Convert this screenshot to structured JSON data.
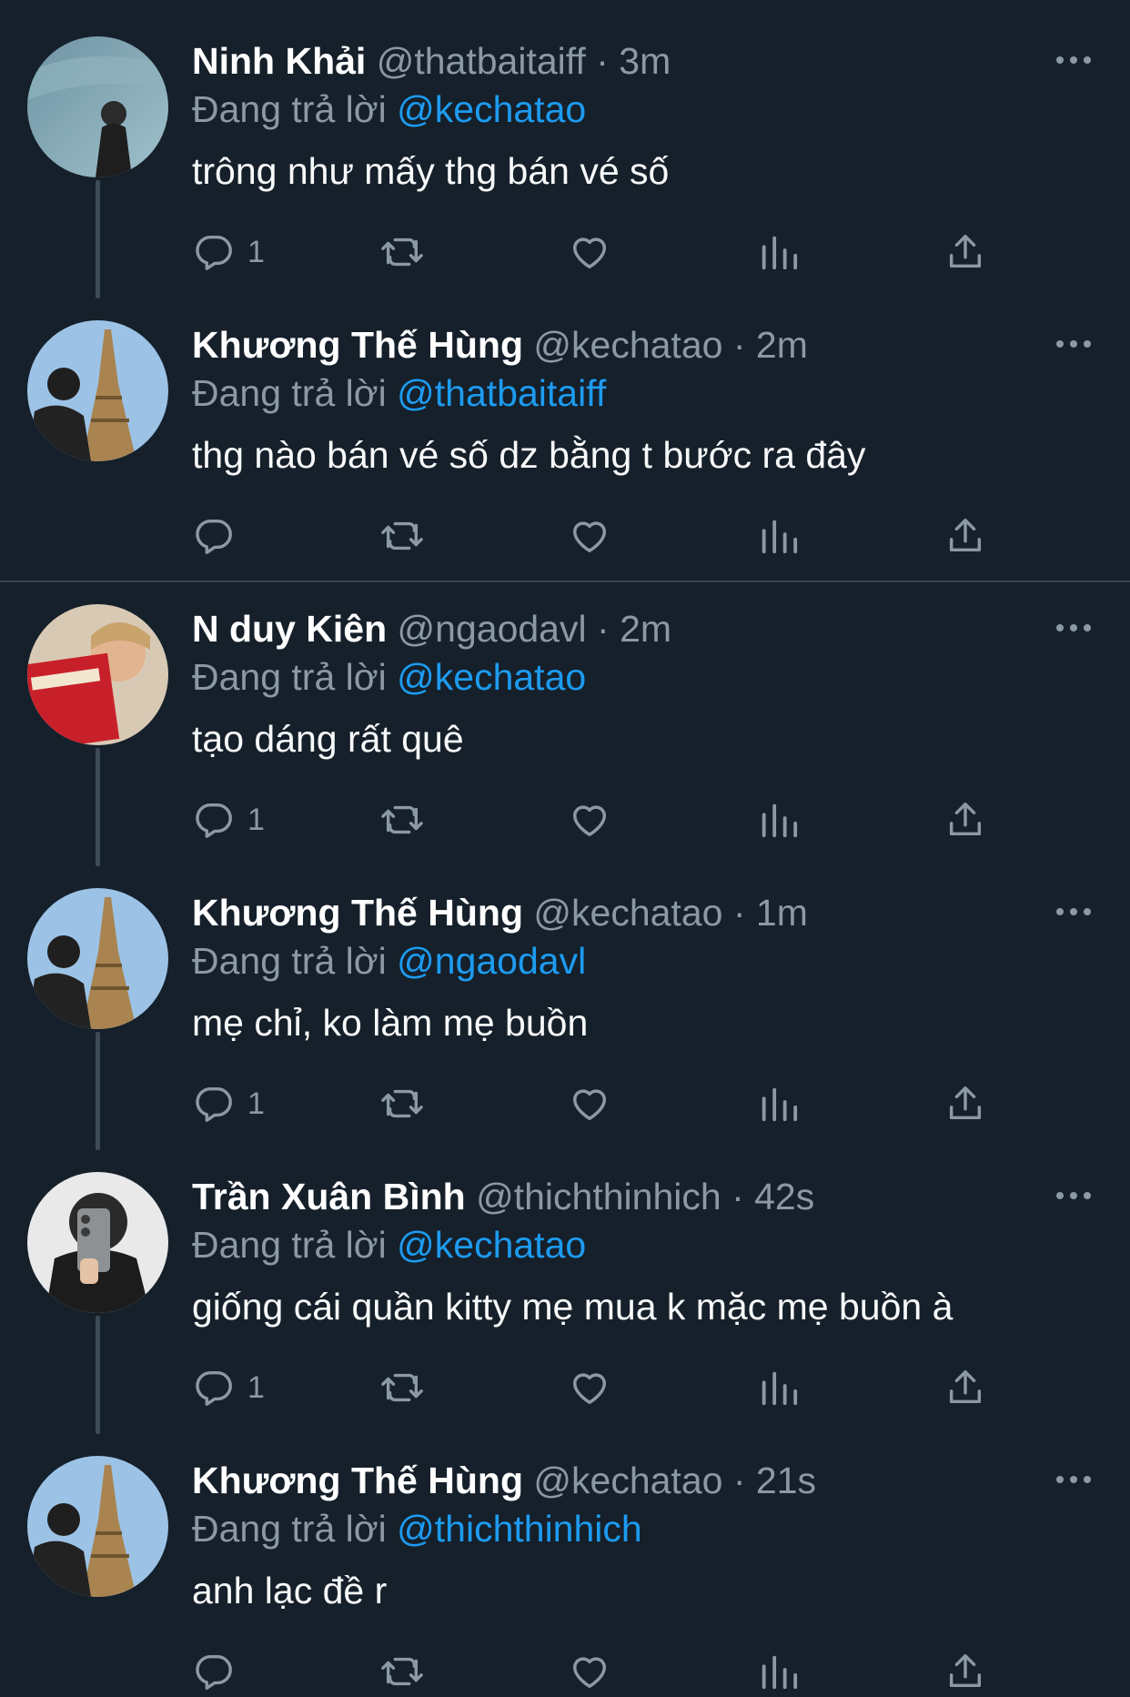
{
  "theme": {
    "background": "#15202b",
    "text_primary": "#ffffff",
    "text_secondary": "#8b98a5",
    "accent": "#1d9bf0",
    "thread_line": "#3d4a57",
    "divider": "#38444d"
  },
  "reply_prefix": "Đang trả lời",
  "icons": {
    "reply": "reply-bubble-icon",
    "retweet": "retweet-icon",
    "like": "heart-icon",
    "views": "views-bar-chart-icon",
    "share": "share-upload-icon",
    "more": "more-dots-icon"
  },
  "tweets": [
    {
      "display_name": "Ninh Khải",
      "handle": "@thatbaitaiff",
      "separator": "·",
      "time": "3m",
      "replying_to": "@kechatao",
      "text": "trông như mấy thg bán vé số",
      "reply_count": "1"
    },
    {
      "display_name": "Khương Thế Hùng",
      "handle": "@kechatao",
      "separator": "·",
      "time": "2m",
      "replying_to": "@thatbaitaiff",
      "text": "thg nào bán vé số dz bằng t bước ra đây",
      "reply_count": ""
    },
    {
      "display_name": "N duy Kiên",
      "handle": "@ngaodavl",
      "separator": "·",
      "time": "2m",
      "replying_to": "@kechatao",
      "text": "tạo dáng rất quê",
      "reply_count": "1"
    },
    {
      "display_name": "Khương Thế Hùng",
      "handle": "@kechatao",
      "separator": "·",
      "time": "1m",
      "replying_to": "@ngaodavl",
      "text": "mẹ chỉ, ko làm mẹ buồn",
      "reply_count": "1"
    },
    {
      "display_name": "Trần Xuân Bình",
      "handle": "@thichthinhich",
      "separator": "·",
      "time": "42s",
      "replying_to": "@kechatao",
      "text": "giống cái quần kitty mẹ mua k mặc mẹ buồn à",
      "reply_count": "1"
    },
    {
      "display_name": "Khương Thế Hùng",
      "handle": "@kechatao",
      "separator": "·",
      "time": "21s",
      "replying_to": "@thichthinhich",
      "text": "anh lạc đề r",
      "reply_count": ""
    }
  ]
}
